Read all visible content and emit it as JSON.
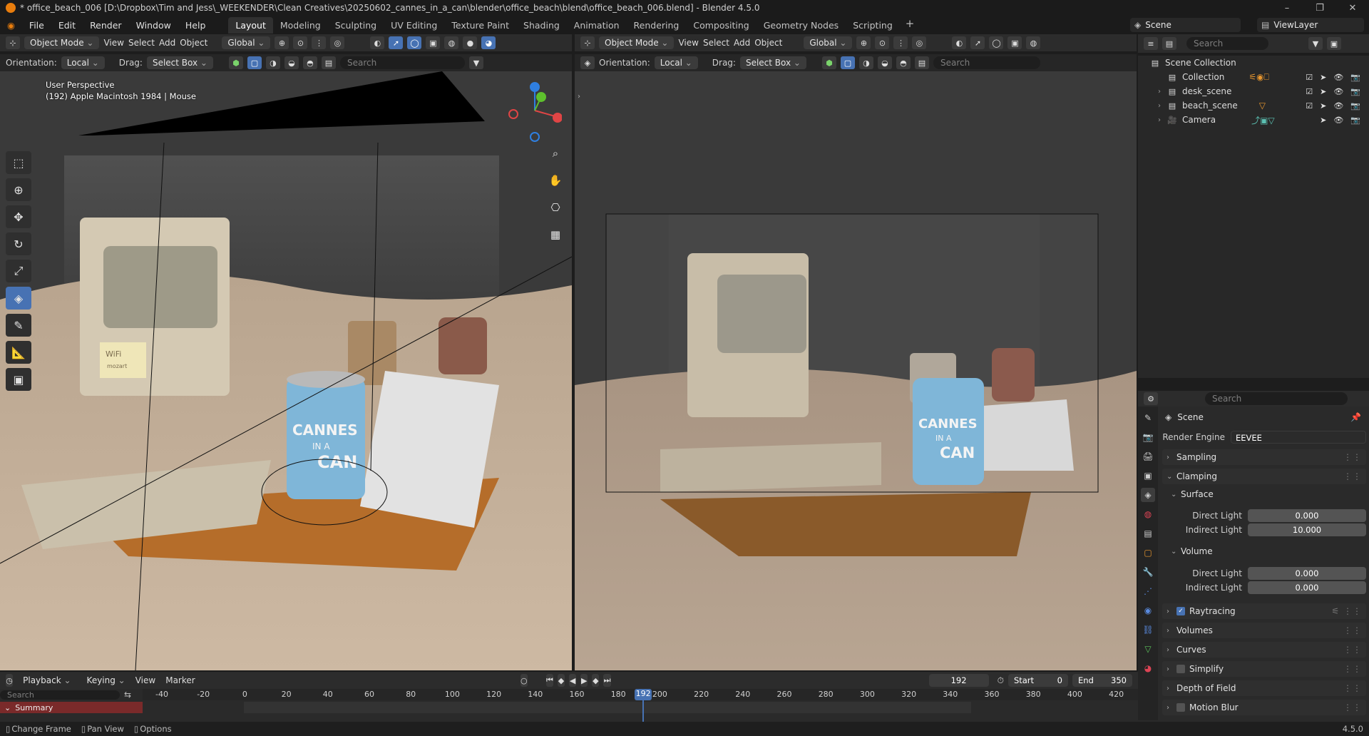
{
  "titlebar": {
    "title": "* office_beach_006 [D:\\Dropbox\\Tim and Jess\\_WEEKENDER\\Clean Creatives\\20250602_cannes_in_a_can\\blender\\office_beach\\blend\\office_beach_006.blend] - Blender 4.5.0",
    "controls": [
      "–",
      "❐",
      "✕"
    ]
  },
  "menu": {
    "items": [
      "File",
      "Edit",
      "Render",
      "Window",
      "Help"
    ],
    "workspaces": [
      "Layout",
      "Modeling",
      "Sculpting",
      "UV Editing",
      "Texture Paint",
      "Shading",
      "Animation",
      "Rendering",
      "Compositing",
      "Geometry Nodes",
      "Scripting"
    ],
    "active_workspace": "Layout",
    "scene": "Scene",
    "view_layer": "ViewLayer"
  },
  "viewport_left": {
    "mode": "Object Mode",
    "menus": [
      "View",
      "Select",
      "Add",
      "Object"
    ],
    "transform": "Global",
    "orientation_label": "Orientation:",
    "orientation": "Local",
    "drag_label": "Drag:",
    "drag": "Select Box",
    "search_placeholder": "Search",
    "overlay_line1": "User Perspective",
    "overlay_line2": "(192) Apple Macintosh 1984 | Mouse"
  },
  "viewport_right": {
    "mode": "Object Mode",
    "menus": [
      "View",
      "Select",
      "Add",
      "Object"
    ],
    "transform": "Global",
    "orientation_label": "Orientation:",
    "orientation": "Local",
    "drag_label": "Drag:",
    "drag": "Select Box",
    "search_placeholder": "Search"
  },
  "scene_art": {
    "can_title_1": "CANNES",
    "can_title_2": "IN A",
    "can_title_3": "CAN",
    "note_text": "WiFi",
    "note_sub": "mozart"
  },
  "outliner": {
    "search_placeholder": "Search",
    "root": "Scene Collection",
    "items": [
      {
        "name": "Collection",
        "expand": ""
      },
      {
        "name": "desk_scene",
        "expand": "›"
      },
      {
        "name": "beach_scene",
        "expand": "›"
      },
      {
        "name": "Camera",
        "expand": "›"
      }
    ]
  },
  "properties": {
    "search_placeholder": "Search",
    "context": "Scene",
    "render_engine_label": "Render Engine",
    "render_engine": "EEVEE",
    "sampling": "Sampling",
    "clamping": "Clamping",
    "surface": "Surface",
    "surface_direct_label": "Direct Light",
    "surface_direct": "0.000",
    "surface_indirect_label": "Indirect Light",
    "surface_indirect": "10.000",
    "volume": "Volume",
    "volume_direct_label": "Direct Light",
    "volume_direct": "0.000",
    "volume_indirect_label": "Indirect Light",
    "volume_indirect": "0.000",
    "raytracing": "Raytracing",
    "volumes": "Volumes",
    "curves": "Curves",
    "simplify": "Simplify",
    "depth_of_field": "Depth of Field",
    "motion_blur": "Motion Blur"
  },
  "timeline": {
    "menus": [
      "Playback",
      "Keying",
      "View",
      "Marker"
    ],
    "current_frame": "192",
    "start_label": "Start",
    "start": "0",
    "end_label": "End",
    "end": "350",
    "search_placeholder": "Search",
    "summary": "Summary",
    "ticks": [
      "-40",
      "-20",
      "0",
      "20",
      "40",
      "60",
      "80",
      "100",
      "120",
      "140",
      "160",
      "180",
      "200",
      "220",
      "240",
      "260",
      "280",
      "300",
      "320",
      "340",
      "360",
      "380",
      "400",
      "420"
    ]
  },
  "status": {
    "change_frame": "Change Frame",
    "pan_view": "Pan View",
    "options": "Options",
    "version": "4.5.0"
  }
}
